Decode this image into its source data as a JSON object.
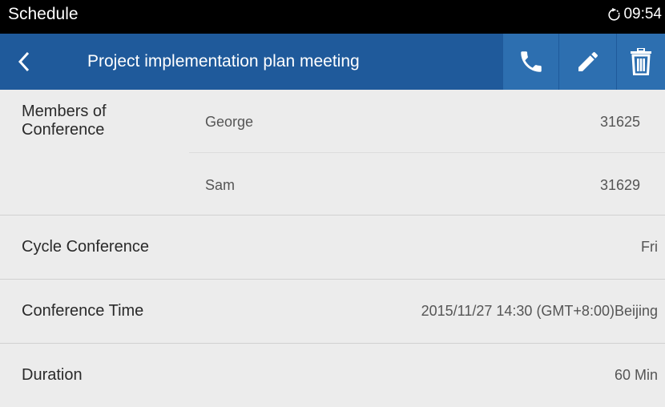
{
  "status_bar": {
    "app_name": "Schedule",
    "time": "09:54",
    "sync_icon": "sync-icon"
  },
  "app_bar": {
    "title": "Project implementation plan meeting",
    "back_icon": "chevron-left-icon",
    "actions": [
      "phone-icon",
      "pencil-icon",
      "trash-icon"
    ],
    "color": "#1f5a9b",
    "action_color": "#2d6fb0"
  },
  "members": {
    "label": "Members of Conference",
    "items": [
      {
        "name": "George",
        "number": "31625"
      },
      {
        "name": "Sam",
        "number": "31629"
      }
    ]
  },
  "cycle": {
    "label": "Cycle Conference",
    "value": "Fri"
  },
  "time": {
    "label": "Conference Time",
    "value": "2015/11/27 14:30 (GMT+8:00)Beijing"
  },
  "duration": {
    "label": "Duration",
    "value": "60 Min"
  }
}
